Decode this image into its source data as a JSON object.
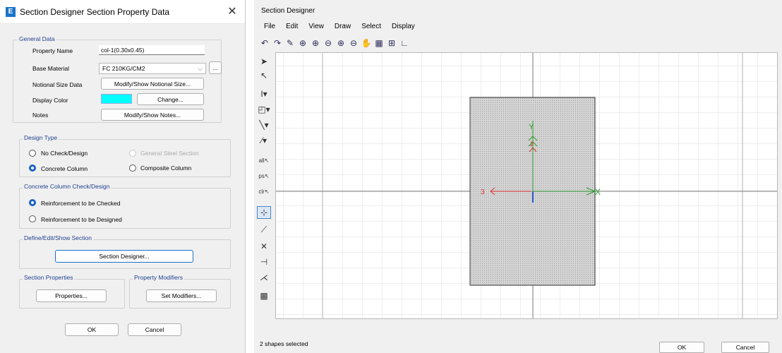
{
  "dialog": {
    "app_icon": "E",
    "title": "Section Designer Section Property Data",
    "close": "✕",
    "general": {
      "title": "General Data",
      "property_name_label": "Property Name",
      "property_name_value": "col-1(0.30x0.45)",
      "base_material_label": "Base Material",
      "base_material_value": "FC 210KG/CM2",
      "base_material_more": "...",
      "notional_label": "Notional Size Data",
      "notional_button": "Modify/Show Notional Size...",
      "display_color_label": "Display Color",
      "display_color": "#00ffff",
      "change_button": "Change...",
      "notes_label": "Notes",
      "notes_button": "Modify/Show Notes..."
    },
    "design_type": {
      "title": "Design Type",
      "no_check": "No Check/Design",
      "general_steel": "General Steel Section",
      "concrete_column": "Concrete Column",
      "composite_column": "Composite Column"
    },
    "ccc": {
      "title": "Concrete Column Check/Design",
      "checked": "Reinforcement to be Checked",
      "designed": "Reinforcement to be Designed"
    },
    "define": {
      "title": "Define/Edit/Show Section",
      "button": "Section Designer..."
    },
    "section_props": {
      "title": "Section Properties",
      "button": "Properties..."
    },
    "modifiers": {
      "title": "Property Modifiers",
      "button": "Set Modifiers..."
    },
    "ok": "OK",
    "cancel": "Cancel"
  },
  "designer": {
    "title": "Section Designer",
    "menu": [
      "File",
      "Edit",
      "View",
      "Draw",
      "Select",
      "Display"
    ],
    "toolbar_icons": [
      "undo-icon",
      "redo-icon",
      "pencil-icon",
      "zoom-window-icon",
      "zoom-in-icon",
      "zoom-out-icon",
      "zoom-previous-icon",
      "zoom-fit-icon",
      "pan-icon",
      "grid-table-icon",
      "snap-icon",
      "angle-icon"
    ],
    "tool_icons": [
      "pointer-icon",
      "reshape-icon",
      "i-section-icon",
      "shape-icon",
      "line-icon",
      "rebar-icon",
      "select-all-icon",
      "select-previous-icon",
      "clear-selection-icon",
      "snap-to-point-icon",
      "snap-to-line-icon",
      "snap-intersection-icon",
      "snap-perpendicular-icon",
      "snap-edge-icon",
      "fill-pattern-icon"
    ],
    "axis_y": "Y",
    "axis_2": "2",
    "axis_3": "3",
    "axis_x": "X",
    "status": "2 shapes selected",
    "ok": "OK",
    "cancel": "Cancel"
  }
}
